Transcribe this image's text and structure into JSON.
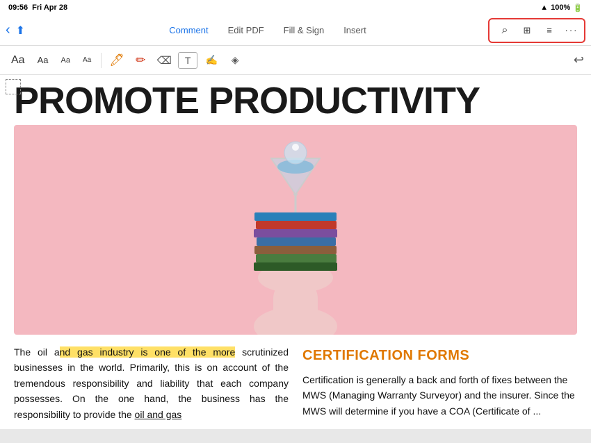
{
  "statusBar": {
    "time": "09:56",
    "day": "Fri Apr 28",
    "battery": "100%",
    "wifi": "100%"
  },
  "navBar": {
    "tabs": [
      {
        "id": "comment",
        "label": "Comment",
        "active": true
      },
      {
        "id": "edit-pdf",
        "label": "Edit PDF",
        "active": false
      },
      {
        "id": "fill-sign",
        "label": "Fill & Sign",
        "active": false
      },
      {
        "id": "insert",
        "label": "Insert",
        "active": false
      }
    ],
    "dotsLabel": "···"
  },
  "toolbar": {
    "aaLargeLabel": "Aa",
    "aaMediumLabel": "Aa",
    "aaSmallLabel": "Aa",
    "aaXsLabel": "Aa",
    "undoLabel": "↩"
  },
  "content": {
    "heading": "PROMOTE PRODUCTIVITY",
    "leftColumn": "The oil and gas industry is one of the more scrutinized businesses in the world. Primarily, this is on account of the tremendous responsibility and liability that each company possesses. On the one hand, the business has the responsibility to provide the oil and gas",
    "highlightedText": "nd gas industry is one of the more",
    "certHeading": "CERTIFICATION FORMS",
    "rightColumn": "Certification is generally a back and forth of fixes between the MWS (Managing Warranty Surveyor) and the insurer. Since the MWS will determine if you have a COA (Certificate of ..."
  },
  "icons": {
    "back": "‹",
    "share": "⬆",
    "search": "⌕",
    "grid": "⊞",
    "reader": "≡",
    "more": "···",
    "pencilOrange": "✏",
    "pencilRed": "✏",
    "eraser": "⌫",
    "textBox": "T",
    "comment": "◻",
    "stamp": "◈",
    "selectionRect": "⬚",
    "undo": "↩"
  },
  "colors": {
    "accent": "#1a73e8",
    "certHeading": "#e07800",
    "highlightYellow": "#ffe066",
    "redBorder": "#e53935",
    "navBg": "#ffffff",
    "heroBg": "#f4b8c0"
  }
}
